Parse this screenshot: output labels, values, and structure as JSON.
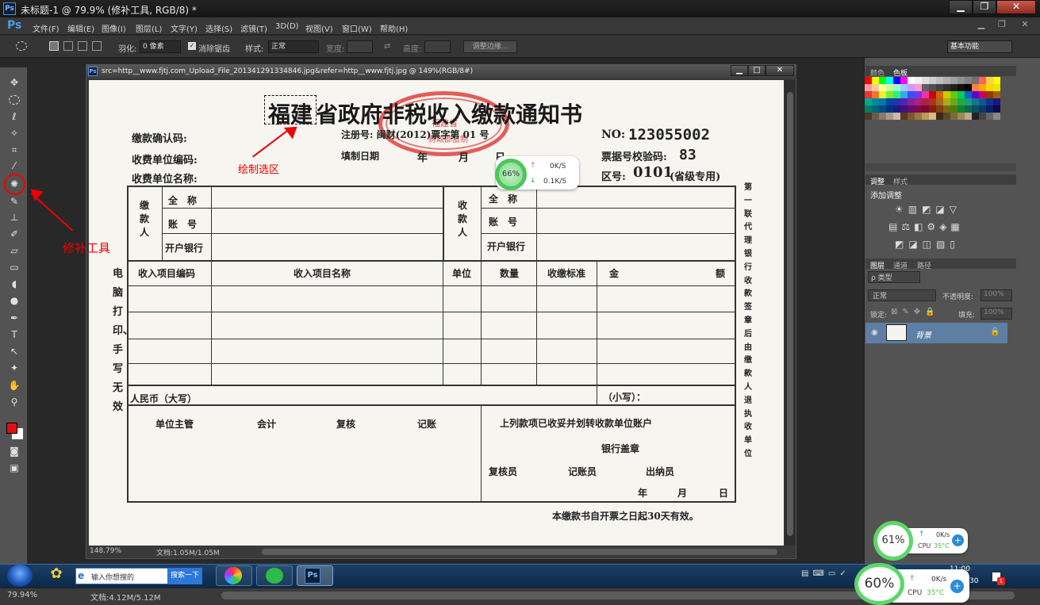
{
  "window": {
    "title": "未标题-1 @ 79.9% (修补工具, RGB/8) *",
    "app_icon": "Ps",
    "minimize": "▁",
    "restore": "❐",
    "close": "✕"
  },
  "menubar": {
    "brand": "Ps",
    "items": [
      "文件(F)",
      "编辑(E)",
      "图像(I)",
      "图层(L)",
      "文字(Y)",
      "选择(S)",
      "滤镜(T)",
      "3D(D)",
      "视图(V)",
      "窗口(W)",
      "帮助(H)"
    ]
  },
  "options": {
    "feather_label": "羽化:",
    "feather_value": "0 像素",
    "antialias": "消除锯齿",
    "style_label": "样式:",
    "style_value": "正常",
    "width_label": "宽度:",
    "height_label": "高度:",
    "refine_btn": "调整边缘...",
    "workspace": "基本功能"
  },
  "document": {
    "icon": "Ps",
    "title": "src=http__www.fjtj.com_Upload_File_201341291334846.jpg&refer=http__www.fjtj.jpg @ 149%(RGB/8#)",
    "zoom": "148.79%",
    "doc_size": "文档:1.05M/1.05M"
  },
  "form": {
    "title_a": "福建",
    "title_b": "省政府非税收入缴款通知书",
    "confirm_code": "缴款确认码:",
    "reg_no": "注册号: 闽财(2012)票字第 01 号",
    "no_label": "NO:",
    "no_value": "123055002",
    "unit_code": "收费单位编码:",
    "fill_date": "填制日期",
    "year": "年",
    "month": "月",
    "day": "日",
    "check_code": "票据号校验码:",
    "check_value": "83",
    "unit_name": "收费单位名称:",
    "area": "区号:",
    "area_value": "0101",
    "area_note": "(省级专用)",
    "payer": "缴款人",
    "payee": "收款人",
    "full_name": "全　称",
    "account": "账　号",
    "bank": "开户银行",
    "headers": [
      "收入项目编码",
      "收入项目名称",
      "单位",
      "数量",
      "收缴标准",
      "金",
      "额"
    ],
    "rmb": "人民币（大写）",
    "small": "（小写）：",
    "signers": [
      "单位主管",
      "会计",
      "复核",
      "记账"
    ],
    "transfer": "上列款项已收妥并划转收款单位账户",
    "bank_seal": "银行盖章",
    "reviewer": "复核员",
    "bookkeeper": "记账员",
    "cashier": "出纳员",
    "validity": "本缴款书自开票之日起30天有效。",
    "left_side": "电脑打印、手写无效",
    "right_side": "第一联代理银行收款签章后由缴款人退执收单位",
    "stamp_top": "福建省",
    "stamp_bottom": "财政部监制"
  },
  "annotations": {
    "selection": "绘制选区",
    "patch_tool": "修补工具"
  },
  "float_badge": {
    "pct": "66%",
    "up": "0K/S",
    "down": "0.1K/S"
  },
  "panels": {
    "color_tabs": [
      "颜色",
      "色板"
    ],
    "adjust_tabs": [
      "调整",
      "样式"
    ],
    "adjust_hint": "添加调整",
    "layer_tabs": [
      "图层",
      "通道",
      "路径"
    ],
    "layer_kind": "ρ 类型",
    "blend_mode": "正常",
    "opacity_label": "不透明度:",
    "opacity_value": "100%",
    "lock_label": "锁定:",
    "fill_label": "填充:",
    "fill_value": "100%",
    "layer_name": "背景"
  },
  "taskbar": {
    "search_placeholder": "输入你想搜的",
    "search_btn": "搜索一下",
    "time": "11:00",
    "date": "30"
  },
  "net1": {
    "pct": "61%",
    "up": "0K/s",
    "cpu": "CPU",
    "temp": "35°C"
  },
  "net2": {
    "pct": "60%",
    "up": "0K/s",
    "cpu": "CPU",
    "temp": "35°C"
  },
  "bottom": {
    "zoom": "79.94%",
    "doc_size": "文档:4.12M/5.12M"
  },
  "swatch_colors": [
    "#ff0000",
    "#ffff00",
    "#00ff00",
    "#00ffff",
    "#0000ff",
    "#ff00ff",
    "#ffffff",
    "#f0f0f0",
    "#e0e0e0",
    "#d0d0d0",
    "#c0c0c0",
    "#b0b0b0",
    "#a0a0a0",
    "#909090",
    "#808080",
    "#707070",
    "#ff6060",
    "#ffd040",
    "#ffff00",
    "#ff9999",
    "#ffcc99",
    "#ffff99",
    "#ccff99",
    "#99ffcc",
    "#99ccff",
    "#cc99ff",
    "#ff99cc",
    "#606060",
    "#505050",
    "#404040",
    "#303030",
    "#202020",
    "#101010",
    "#000000",
    "#ff8040",
    "#ffaa00",
    "#ffd700",
    "#e6e600",
    "#ee3333",
    "#ee7733",
    "#eeee33",
    "#77ee33",
    "#33ee77",
    "#33aaee",
    "#3355ee",
    "#7733ee",
    "#ee33aa",
    "#cc0000",
    "#cc6600",
    "#cccc00",
    "#66cc00",
    "#00cc66",
    "#0066cc",
    "#6600cc",
    "#cc0066",
    "#993300",
    "#996600",
    "#00aa88",
    "#008899",
    "#0077aa",
    "#0044aa",
    "#2233aa",
    "#5522aa",
    "#882299",
    "#aa2277",
    "#aa2244",
    "#aa3322",
    "#aa6622",
    "#aaaa22",
    "#66aa22",
    "#22aa44",
    "#229977",
    "#117788",
    "#115599",
    "#113388",
    "#221188",
    "#008060",
    "#006680",
    "#004c80",
    "#003380",
    "#1a1a80",
    "#40107a",
    "#6a0a6a",
    "#800850",
    "#800830",
    "#802010",
    "#804010",
    "#806a10",
    "#4a800a",
    "#108030",
    "#0a6a50",
    "#0a5060",
    "#083a6a",
    "#081e6a",
    "#10084a",
    "#4a3a2a",
    "#6a5a4a",
    "#8a7a6a",
    "#aa9a8a",
    "#cabaaa",
    "#5a3a1a",
    "#7a5a2a",
    "#9a7a3a",
    "#bb9a5a",
    "#daba8a",
    "#3a2a1a",
    "#5a4a2a",
    "#7a6a3a",
    "#9a8a5a",
    "#bba98a",
    "#222222",
    "#444444",
    "#666666",
    "#888888"
  ]
}
